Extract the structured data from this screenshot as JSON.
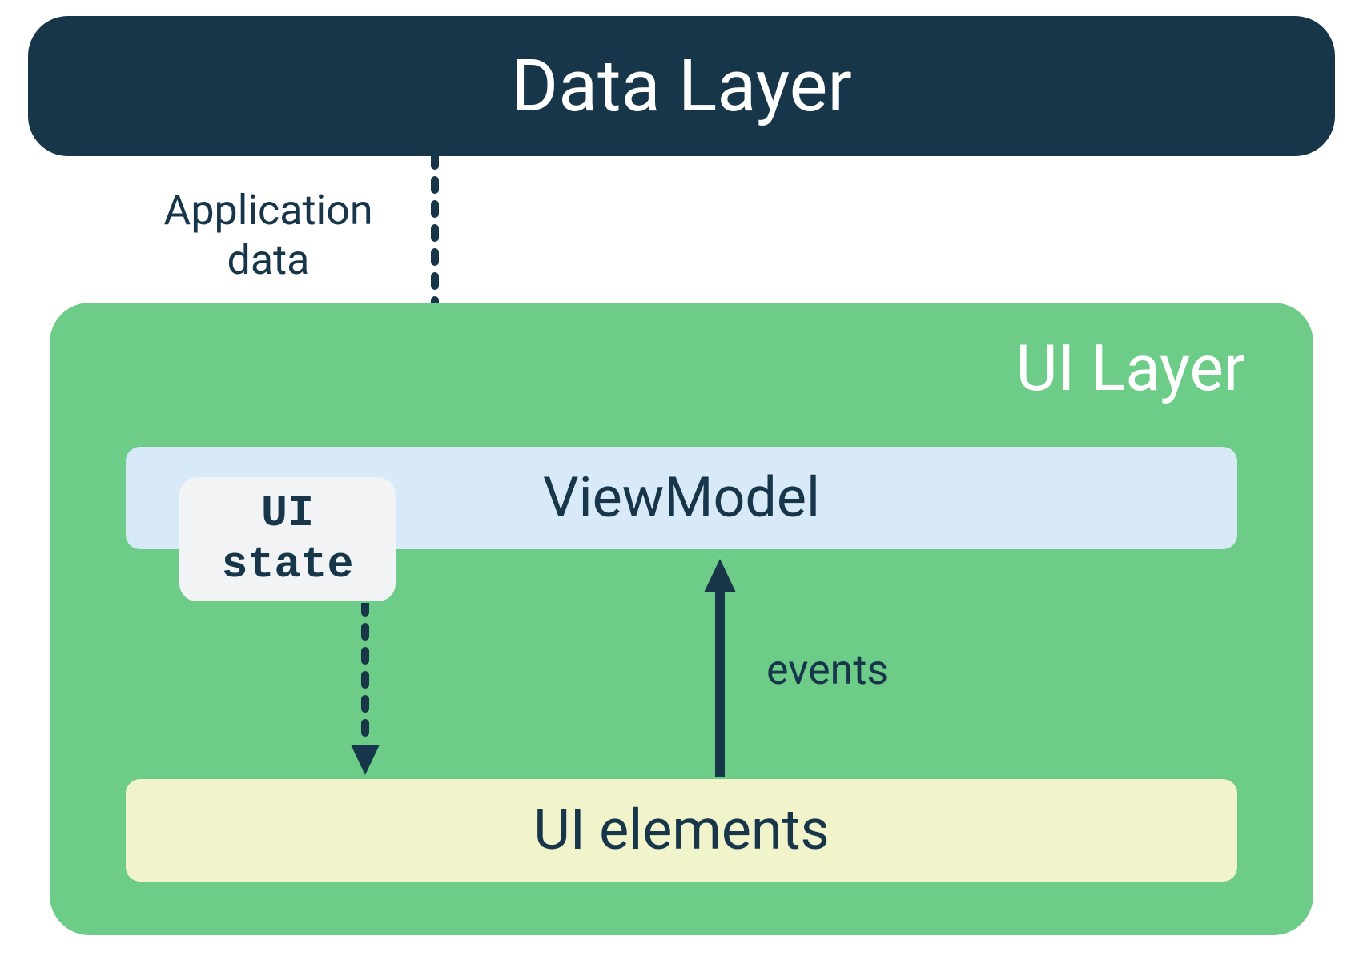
{
  "data_layer": {
    "label": "Data Layer"
  },
  "arrows": {
    "app_data_label_line1": "Application",
    "app_data_label_line2": "data",
    "events_label": "events"
  },
  "ui_layer": {
    "label": "UI Layer",
    "viewmodel_label": "ViewModel",
    "ui_state_label_line1": "UI",
    "ui_state_label_line2": "state",
    "ui_elements_label": "UI elements"
  },
  "colors": {
    "dark_navy": "#17364a",
    "green": "#6dcc87",
    "light_blue": "#d8e9f7",
    "light_yellow": "#f1f4ca",
    "light_gray": "#f1f3f4",
    "white": "#ffffff"
  }
}
